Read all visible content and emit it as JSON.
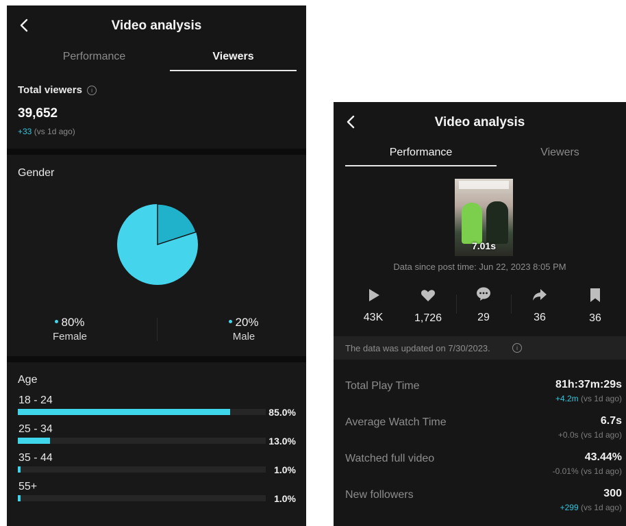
{
  "left_screen": {
    "title": "Video analysis",
    "tabs": [
      {
        "label": "Performance",
        "active": false
      },
      {
        "label": "Viewers",
        "active": true
      }
    ],
    "total_viewers": {
      "label": "Total viewers",
      "value": "39,652",
      "delta": "+33",
      "delta_note": "(vs 1d ago)"
    },
    "gender": {
      "heading": "Gender",
      "female": {
        "pct": "80%",
        "label": "Female",
        "value": 0.8
      },
      "male": {
        "pct": "20%",
        "label": "Male",
        "value": 0.2
      }
    },
    "age": {
      "heading": "Age",
      "rows": [
        {
          "label": "18 - 24",
          "pct": "85.0%",
          "value": 0.85
        },
        {
          "label": "25 - 34",
          "pct": "13.0%",
          "value": 0.13
        },
        {
          "label": "35 - 44",
          "pct": "1.0%",
          "value": 0.01
        },
        {
          "label": "55+",
          "pct": "1.0%",
          "value": 0.01
        }
      ]
    }
  },
  "right_screen": {
    "title": "Video analysis",
    "tabs": [
      {
        "label": "Performance",
        "active": true
      },
      {
        "label": "Viewers",
        "active": false
      }
    ],
    "thumbnail": {
      "duration": "7.01s"
    },
    "data_since": "Data since post time: Jun 22, 2023 8:05 PM",
    "stats": [
      {
        "icon": "play-icon",
        "value": "43K"
      },
      {
        "icon": "heart-icon",
        "value": "1,726"
      },
      {
        "icon": "comment-icon",
        "value": "29"
      },
      {
        "icon": "share-icon",
        "value": "36"
      },
      {
        "icon": "bookmark-icon",
        "value": "36"
      }
    ],
    "updated_note": "The data was updated on 7/30/2023.",
    "metrics": [
      {
        "label": "Total Play Time",
        "value": "81h:37m:29s",
        "delta": "+4.2m",
        "delta_note": "(vs 1d ago)",
        "delta_color": "#34c6dc"
      },
      {
        "label": "Average Watch Time",
        "value": "6.7s",
        "delta": "+0.0s",
        "delta_note": "(vs 1d ago)",
        "delta_color": "#7d7d7d"
      },
      {
        "label": "Watched full video",
        "value": "43.44%",
        "delta": "-0.01%",
        "delta_note": "(vs 1d ago)",
        "delta_color": "#7d7d7d"
      },
      {
        "label": "New followers",
        "value": "300",
        "delta": "+299",
        "delta_note": "(vs 1d ago)",
        "delta_color": "#34c6dc"
      }
    ]
  },
  "colors": {
    "accent": "#34c6dc",
    "pie_main": "#44d4ec",
    "pie_minor": "#1fb2ca",
    "bar": "#3fd6ec",
    "background": "#161616"
  }
}
